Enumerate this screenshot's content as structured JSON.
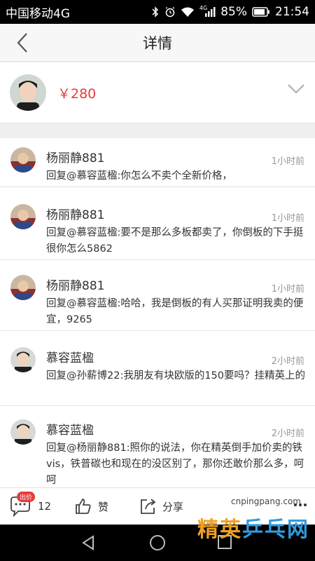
{
  "status_bar": {
    "carrier": "中国移动4G",
    "network_label": "4G",
    "battery": "85%",
    "time": "21:54",
    "icons": [
      "bluetooth-icon",
      "alarm-icon",
      "wifi-icon",
      "signal-icon",
      "battery-icon"
    ]
  },
  "header": {
    "title": "详情",
    "back_icon": "chevron-left-icon"
  },
  "listing": {
    "price": "￥280",
    "expand_icon": "chevron-down-icon"
  },
  "comments": [
    {
      "user": "杨丽静881",
      "time": "1小时前",
      "text": "回复@慕容蓝楹:你怎么不卖个全新价格，"
    },
    {
      "user": "杨丽静881",
      "time": "1小时前",
      "text": "回复@慕容蓝楹:要不是那么多板都卖了，你倒板的下手挺很你怎么5862"
    },
    {
      "user": "杨丽静881",
      "time": "1小时前",
      "text": "回复@慕容蓝楹:哈哈，我是倒板的有人买那证明我卖的便宜，9265"
    },
    {
      "user": "慕容蓝楹",
      "time": "2小时前",
      "text": "回复@孙薪博22:我朋友有块欧版的150要吗？挂精英上的"
    },
    {
      "user": "慕容蓝楹",
      "time": "2小时前",
      "text": "回复@杨丽静881:照你的说法，你在精英倒手加价卖的铁vis，铁普碳也和现在的没区别了，那你还敢价那么多，呵呵"
    }
  ],
  "actions": {
    "bid_badge": "出价",
    "comment_count": "12",
    "like_label": "赞",
    "share_label": "分享"
  },
  "watermark": {
    "url": "cnpingpang.com",
    "logo_a": "精英",
    "logo_b": "乒乓网"
  },
  "colors": {
    "accent_red": "#e63b3b",
    "status_bar_bg": "#000000"
  }
}
